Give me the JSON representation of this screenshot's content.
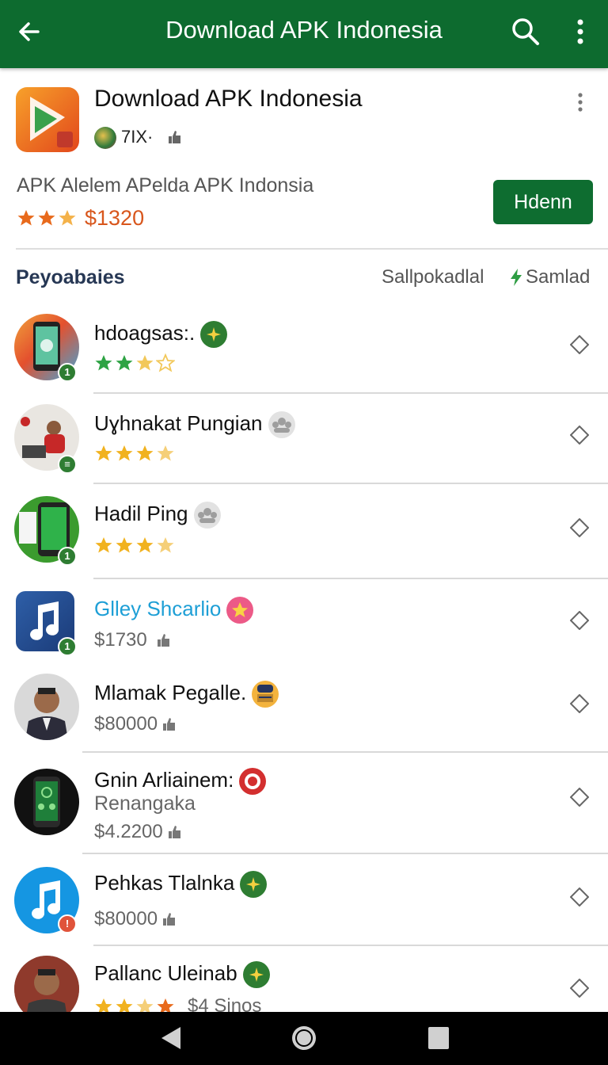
{
  "appbar": {
    "title": "Download APK Indonesia",
    "back_icon": "arrow-back-icon",
    "search_icon": "search-icon",
    "more_icon": "more-vert-icon"
  },
  "header": {
    "title": "Download APK Indonesia",
    "developer": "7IX·",
    "description": "APK Alelem APelda APK Indonsia",
    "price": "$1320",
    "install_button": "Hdenn",
    "rating_stars": 2.5
  },
  "section": {
    "title": "Peyoabaies",
    "link1": "Sallpokadlal",
    "link2": "Samlad"
  },
  "items": [
    {
      "name": "hdoagsas:.",
      "stars": 2.5,
      "sub": "",
      "price": "",
      "tag_color": "#2e7d32",
      "tag_icon": "plus-badge-icon"
    },
    {
      "name": "Uɣhnakat Pungian",
      "stars": 3.5,
      "sub": "",
      "price": "",
      "tag_color": "#bdbdbd",
      "tag_icon": "group-badge-icon"
    },
    {
      "name": "Hadil Ping",
      "stars": 3.5,
      "sub": "",
      "price": "",
      "tag_color": "#bdbdbd",
      "tag_icon": "group-badge-icon"
    },
    {
      "name": "Glley Shcarlio",
      "stars": 0,
      "sub": "",
      "price": "$1730",
      "tag_color": "#ec5a87",
      "tag_icon": "star-badge-icon",
      "name_color": "#1e9fd6"
    },
    {
      "name": "Mlamak Pegalle.",
      "stars": 0,
      "sub": "",
      "price": "$80000",
      "tag_color": "#f3b33d",
      "tag_icon": "face-badge-icon"
    },
    {
      "name": "Gnin Arliainem:",
      "stars": 0,
      "sub": "Renangaka",
      "price": "$4.2200",
      "tag_color": "#d32f2f",
      "tag_icon": "record-badge-icon"
    },
    {
      "name": "Pehkas Tlalnka",
      "stars": 0,
      "sub": "",
      "price": "$80000",
      "tag_color": "#2e7d32",
      "tag_icon": "plus-badge-icon"
    },
    {
      "name": "Pallanc Uleinab",
      "stars": 2.5,
      "sub": "",
      "price": "$4 Sinos",
      "tag_color": "#2e7d32",
      "tag_icon": "plus-badge-icon"
    }
  ],
  "navbar": {
    "back": "nav-back-icon",
    "home": "nav-home-icon",
    "recents": "nav-recents-icon"
  }
}
